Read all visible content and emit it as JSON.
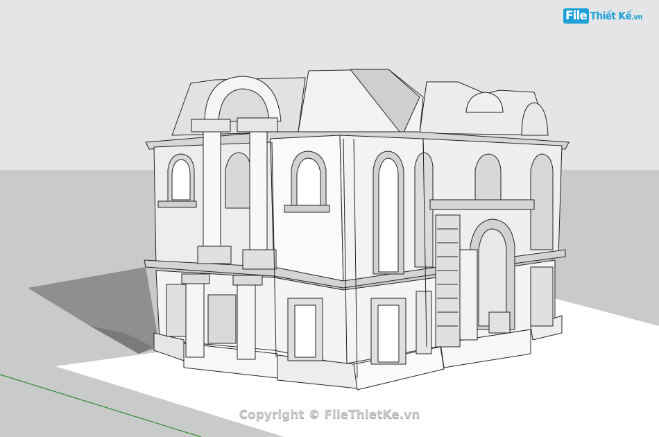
{
  "logo": {
    "badge": "File",
    "name": "Thiết Kế",
    "suffix": ".vn"
  },
  "watermark": "Copyright © FileThietKe.vn",
  "colors": {
    "sky": "#e4e5e6",
    "ground": "#cbcbcb",
    "plot": "#ffffff",
    "shadow": "#8e8e8e",
    "axis_green": "#2e8b2e",
    "brand": "#1da1d8"
  }
}
